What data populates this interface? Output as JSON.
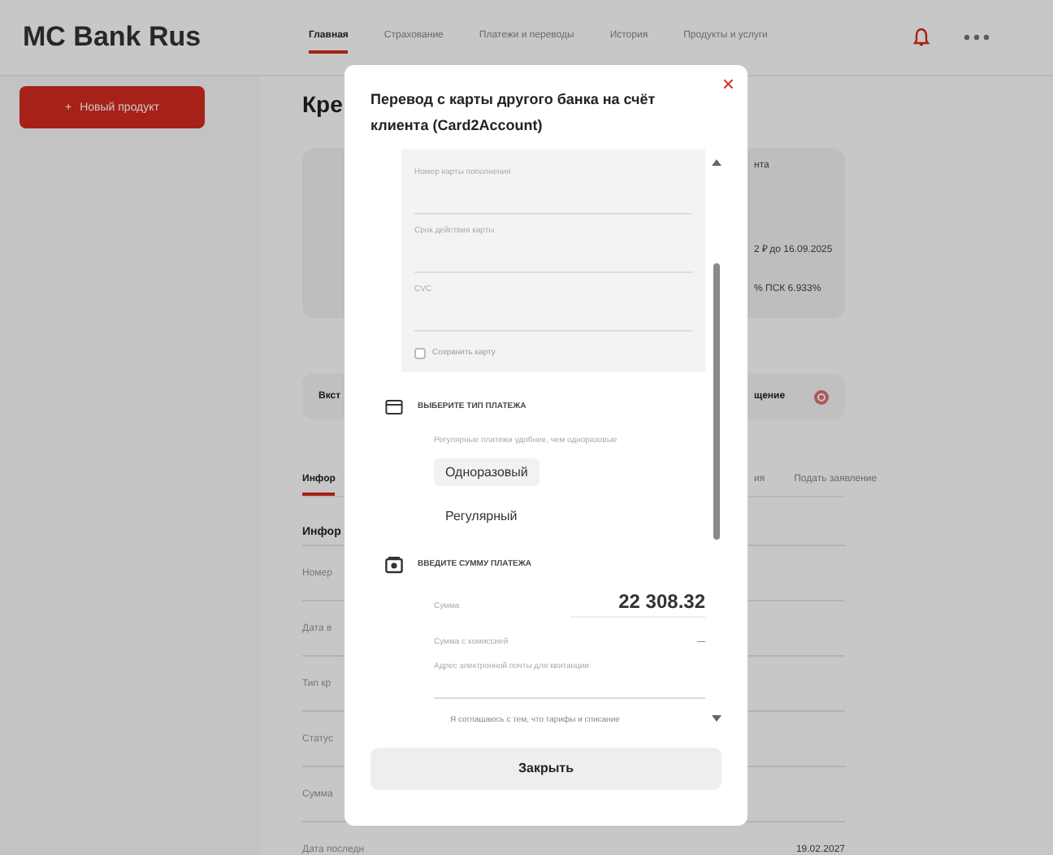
{
  "header": {
    "logo": "MC Bank Rus",
    "nav": [
      {
        "label": "Главная",
        "selected": true
      },
      {
        "label": "Страхование",
        "selected": false
      },
      {
        "label": "Платежи и переводы",
        "selected": false
      },
      {
        "label": "История",
        "selected": false
      },
      {
        "label": "Продукты и услуги",
        "selected": false
      }
    ]
  },
  "sidebar": {
    "new_product_button": "Новый продукт",
    "plus": "+"
  },
  "main": {
    "heading": "Кре",
    "card_lines": [
      {
        "right": "нта"
      },
      {
        "right": "2 ₽ до 16.09.2025"
      },
      {
        "right": "%   ПСК 6.933%"
      }
    ],
    "action_card": {
      "left": "Вкст",
      "right": "щение"
    },
    "tabs": [
      {
        "label": "Инфор",
        "selected": true
      },
      {
        "label": "ия",
        "selected": false
      },
      {
        "label": "Подать заявление",
        "selected": false
      }
    ],
    "info_title": "Инфор",
    "info_rows": [
      {
        "label": "Номер"
      },
      {
        "label": "Дата в"
      },
      {
        "label": "Тип кр"
      },
      {
        "label": "Статус"
      },
      {
        "label": "Сумма"
      },
      {
        "label": "Дата последн",
        "value": "19.02.2027"
      }
    ]
  },
  "modal": {
    "title": "Перевод с карты другого банка на счёт клиента (Card2Account)",
    "close": "×",
    "card_fields": [
      {
        "label": "Номер карты пополнения"
      },
      {
        "label": "Срок действия карты"
      },
      {
        "label": "CVC"
      }
    ],
    "save_card": {
      "label": "Сохранить карту",
      "checked": false
    },
    "payment_type": {
      "heading": "ВЫБЕРИТЕ ТИП ПЛАТЕЖА",
      "hint": "Регулярные платежи удобнее, чем одноразовые",
      "options": [
        {
          "label": "Одноразовый",
          "selected": true
        },
        {
          "label": "Регулярный",
          "selected": false
        }
      ]
    },
    "amount": {
      "heading": "ВВЕДИТЕ СУММУ ПЛАТЕЖА",
      "sum_label": "Сумма",
      "sum_value": "22 308.32",
      "commission_label": "Сумма с комиссией",
      "commission_value": "—",
      "email_placeholder": "Адрес электронной почты для квитанции",
      "consent": "Я соглашаюсь с тем, что тарифы и списание"
    },
    "close_button": "Закрыть"
  }
}
